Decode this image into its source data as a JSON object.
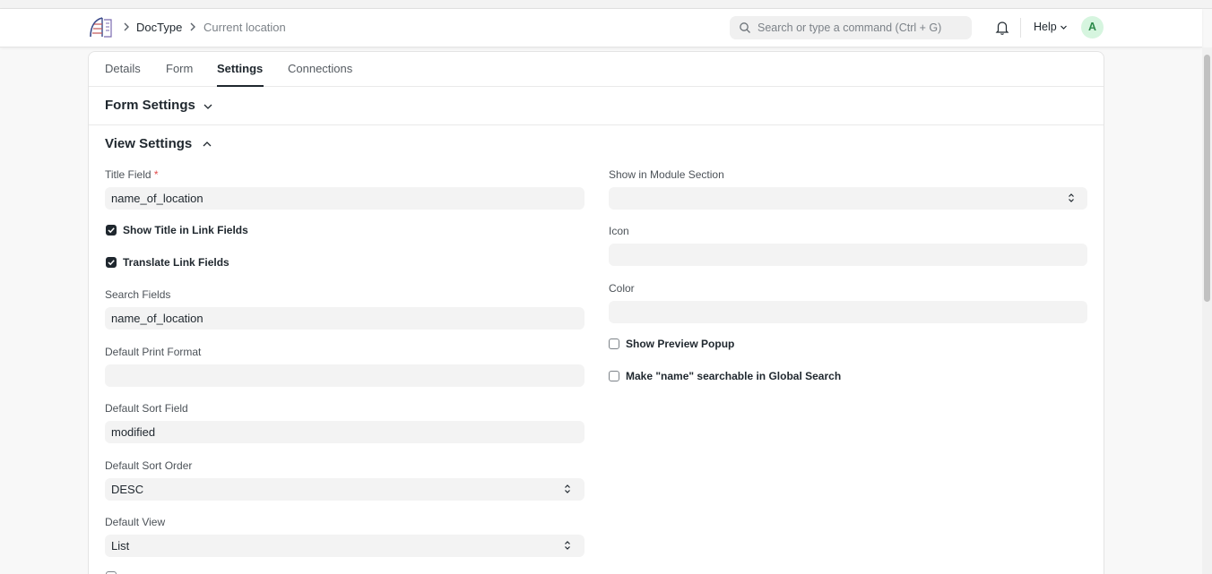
{
  "breadcrumb": {
    "doctype": "DocType",
    "current": "Current location"
  },
  "search": {
    "placeholder": "Search or type a command (Ctrl + G)"
  },
  "header": {
    "help_label": "Help",
    "avatar_initial": "A"
  },
  "tabs": [
    {
      "label": "Details"
    },
    {
      "label": "Form"
    },
    {
      "label": "Settings",
      "active": true
    },
    {
      "label": "Connections"
    }
  ],
  "sections": {
    "form_settings": {
      "title": "Form Settings",
      "collapsed": true
    },
    "view_settings": {
      "title": "View Settings",
      "collapsed": false
    }
  },
  "left_fields": {
    "title_field": {
      "label": "Title Field",
      "required_mark": "*",
      "value": "name_of_location"
    },
    "show_title_in_link_fields": {
      "label": "Show Title in Link Fields",
      "checked": true
    },
    "translate_link_fields": {
      "label": "Translate Link Fields",
      "checked": true
    },
    "search_fields": {
      "label": "Search Fields",
      "value": "name_of_location"
    },
    "default_print_format": {
      "label": "Default Print Format",
      "value": ""
    },
    "default_sort_field": {
      "label": "Default Sort Field",
      "value": "modified"
    },
    "default_sort_order": {
      "label": "Default Sort Order",
      "value": "DESC"
    },
    "default_view": {
      "label": "Default View",
      "value": "List"
    }
  },
  "right_fields": {
    "show_in_module_section": {
      "label": "Show in Module Section",
      "value": ""
    },
    "icon": {
      "label": "Icon",
      "value": ""
    },
    "color": {
      "label": "Color",
      "value": ""
    },
    "show_preview_popup": {
      "label": "Show Preview Popup",
      "checked": false
    },
    "make_name_searchable": {
      "label": "Make \"name\" searchable in Global Search",
      "checked": false
    }
  },
  "colors": {
    "accent": "#1f272e",
    "required": "#e24c4c",
    "field_bg": "#f3f3f3",
    "avatar_bg": "#d6f5df",
    "avatar_fg": "#2c8a4a"
  }
}
